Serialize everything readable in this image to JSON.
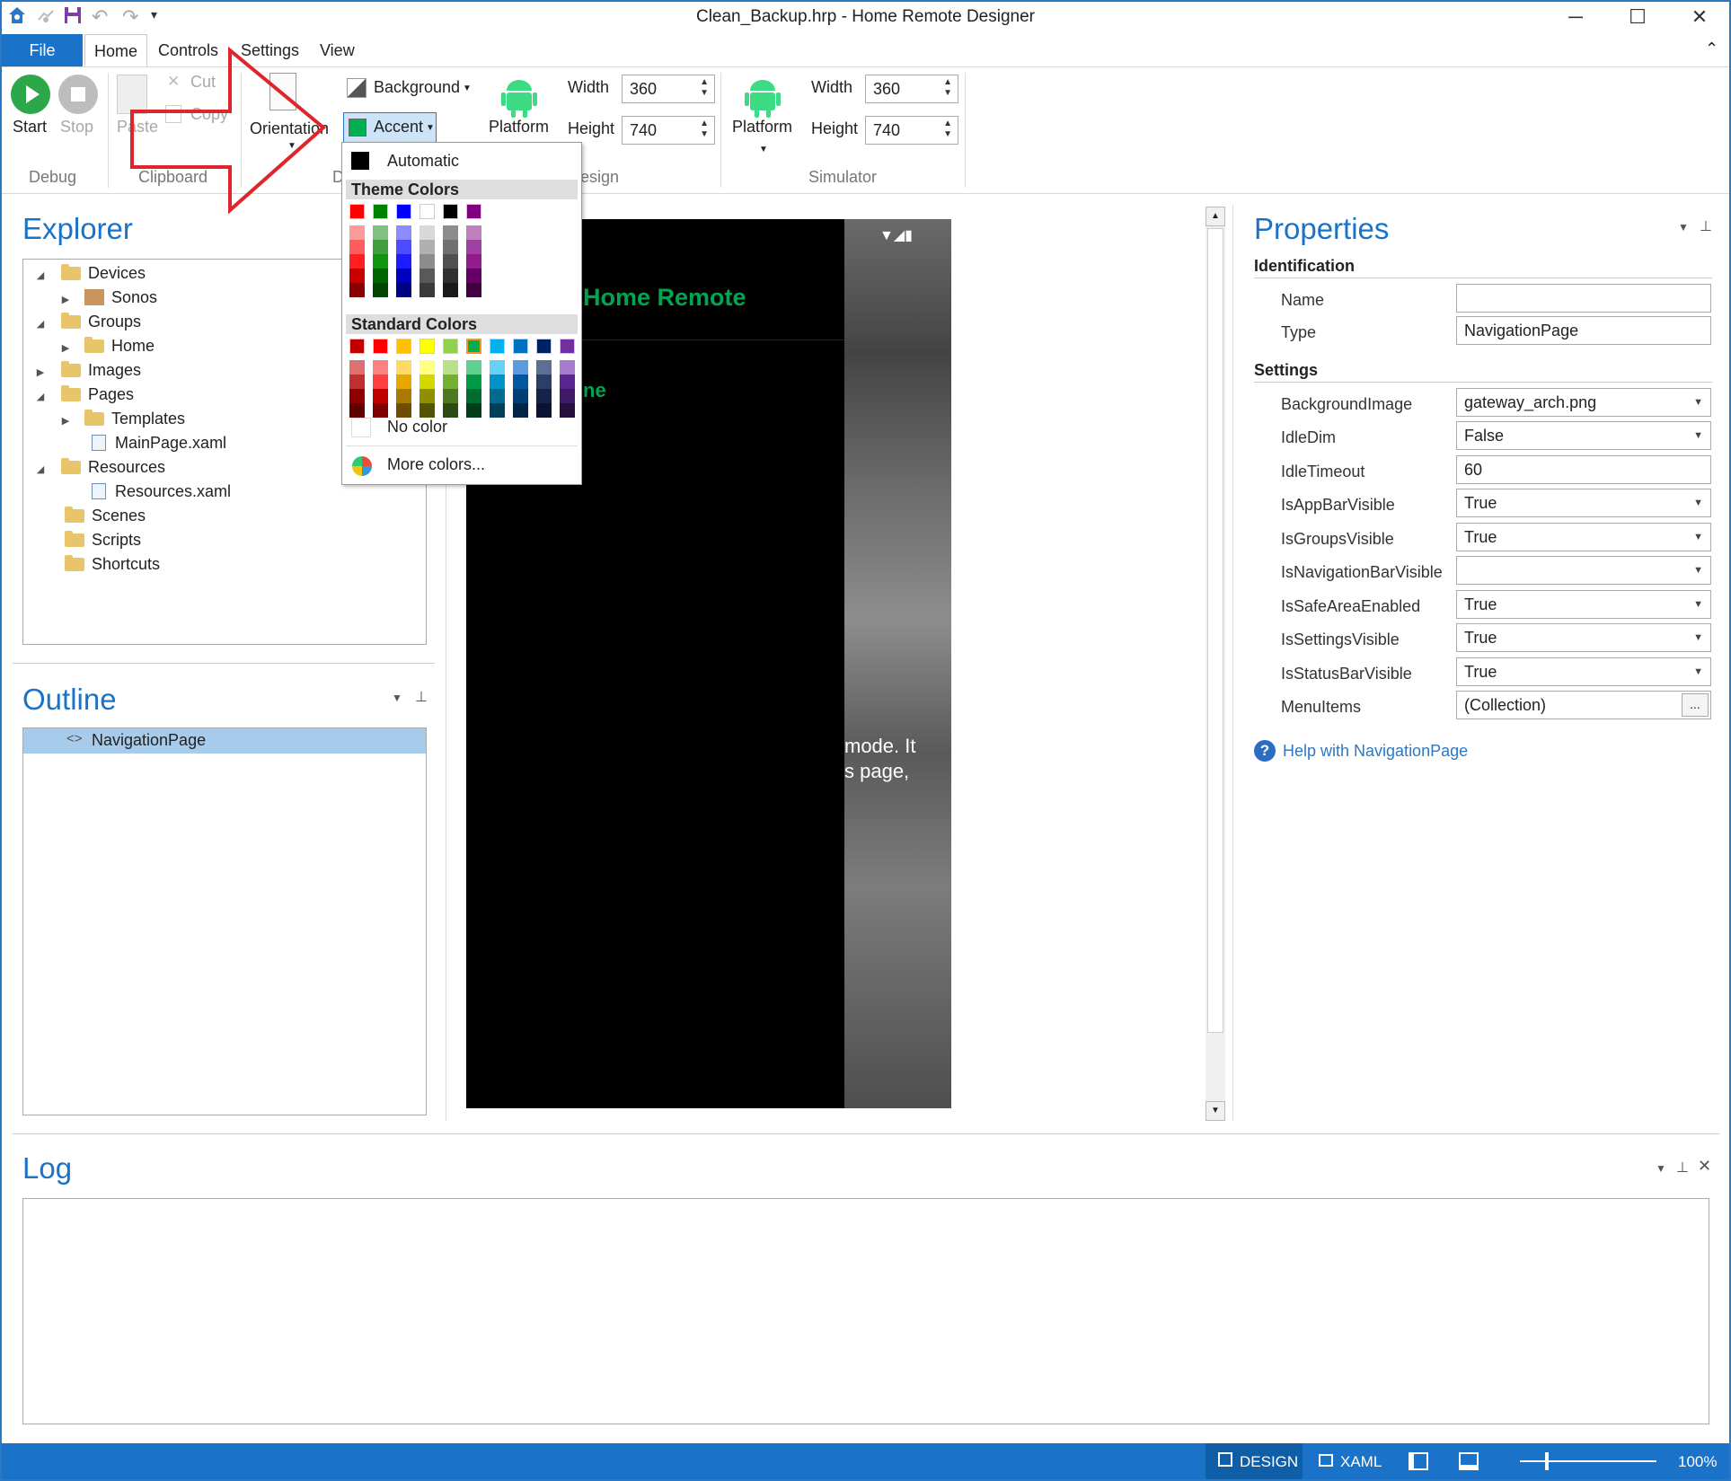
{
  "window": {
    "title": "Clean_Backup.hrp - Home Remote Designer"
  },
  "tabs": {
    "file": "File",
    "home": "Home",
    "controls": "Controls",
    "settings": "Settings",
    "view": "View"
  },
  "ribbon": {
    "start": "Start",
    "stop": "Stop",
    "paste": "Paste",
    "cut": "Cut",
    "copy": "Copy",
    "orientation": "Orientation",
    "background": "Background",
    "accent": "Accent",
    "platform_design": "Platform",
    "platform_sim": "Platform",
    "width_label": "Width",
    "height_label": "Height",
    "design_width": "360",
    "design_height": "740",
    "sim_width": "360",
    "sim_height": "740",
    "group_debug": "Debug",
    "group_clipboard": "Clipboard",
    "group_design_partial_d": "D",
    "group_design_partial": "esign",
    "group_simulator": "Simulator"
  },
  "color_menu": {
    "automatic": "Automatic",
    "theme_colors": "Theme Colors",
    "standard_colors": "Standard Colors",
    "no_color": "No color",
    "more_colors": "More colors...",
    "theme_top": [
      "#ff0000",
      "#008000",
      "#0000ff",
      "#ffffff",
      "#000000",
      "#800080"
    ],
    "theme_shades": [
      [
        "#ff9a9a",
        "#ff5c5c",
        "#ff1f1f",
        "#c80000",
        "#8a0000"
      ],
      [
        "#80c080",
        "#40a040",
        "#119611",
        "#006400",
        "#004400"
      ],
      [
        "#8c8cff",
        "#4d4dff",
        "#1c1cff",
        "#0000c0",
        "#000080"
      ],
      [
        "#d8d8d8",
        "#b0b0b0",
        "#8c8c8c",
        "#595959",
        "#3a3a3a"
      ],
      [
        "#8c8c8c",
        "#707070",
        "#505050",
        "#303030",
        "#1a1a1a"
      ],
      [
        "#c080c0",
        "#a040a0",
        "#901c90",
        "#640064",
        "#400040"
      ]
    ],
    "standard_top": [
      "#c00000",
      "#ff0000",
      "#ffc000",
      "#ffff00",
      "#92d050",
      "#00b050",
      "#00b0f0",
      "#0070c0",
      "#002060",
      "#7030a0"
    ],
    "standard_shades": [
      [
        "#e07070",
        "#c03030",
        "#900000",
        "#600000"
      ],
      [
        "#ff8080",
        "#ff4040",
        "#c00000",
        "#800000"
      ],
      [
        "#ffd966",
        "#e6a700",
        "#a87a00",
        "#6b4e00"
      ],
      [
        "#ffff80",
        "#d6d600",
        "#8f8f00",
        "#545400"
      ],
      [
        "#b9e08a",
        "#73b030",
        "#4d7a20",
        "#2d4a12"
      ],
      [
        "#60d090",
        "#009a45",
        "#006a30",
        "#003d1c"
      ],
      [
        "#66d0f5",
        "#0093c9",
        "#006a91",
        "#003f57"
      ],
      [
        "#5a9be0",
        "#0058a0",
        "#003f73",
        "#002545"
      ],
      [
        "#5c6f95",
        "#2c3d66",
        "#15234a",
        "#0a1330"
      ],
      [
        "#a87ad0",
        "#5a2590",
        "#3f1a66",
        "#24103a"
      ]
    ],
    "accent_color": "#00b050"
  },
  "explorer": {
    "title": "Explorer",
    "items": [
      {
        "label": "Devices"
      },
      {
        "label": "Sonos"
      },
      {
        "label": "Groups"
      },
      {
        "label": "Home"
      },
      {
        "label": "Images"
      },
      {
        "label": "Pages"
      },
      {
        "label": "Templates"
      },
      {
        "label": "MainPage.xaml"
      },
      {
        "label": "Resources"
      },
      {
        "label": "Resources.xaml"
      },
      {
        "label": "Scenes"
      },
      {
        "label": "Scripts"
      },
      {
        "label": "Shortcuts"
      }
    ]
  },
  "outline": {
    "title": "Outline",
    "selected": "NavigationPage"
  },
  "canvas": {
    "app_title": "Home Remote",
    "nav_item_partial": "ne",
    "text_line1": "mode. It",
    "text_line2": "s page,"
  },
  "properties": {
    "title": "Properties",
    "identification": "Identification",
    "settings": "Settings",
    "name_label": "Name",
    "name_value": "",
    "type_label": "Type",
    "type_value": "NavigationPage",
    "rows": [
      {
        "label": "BackgroundImage",
        "value": "gateway_arch.png"
      },
      {
        "label": "IdleDim",
        "value": "False"
      },
      {
        "label": "IdleTimeout",
        "value": "60"
      },
      {
        "label": "IsAppBarVisible",
        "value": "True"
      },
      {
        "label": "IsGroupsVisible",
        "value": "True"
      },
      {
        "label": "IsNavigationBarVisible",
        "value": ""
      },
      {
        "label": "IsSafeAreaEnabled",
        "value": "True"
      },
      {
        "label": "IsSettingsVisible",
        "value": "True"
      },
      {
        "label": "IsStatusBarVisible",
        "value": "True"
      },
      {
        "label": "MenuItems",
        "value": "(Collection)"
      }
    ],
    "menu_items_button": "...",
    "help_link": "Help with NavigationPage"
  },
  "log": {
    "title": "Log"
  },
  "statusbar": {
    "design": "DESIGN",
    "xaml": "XAML",
    "zoom": "100%",
    "zoom_level": 0.2
  }
}
